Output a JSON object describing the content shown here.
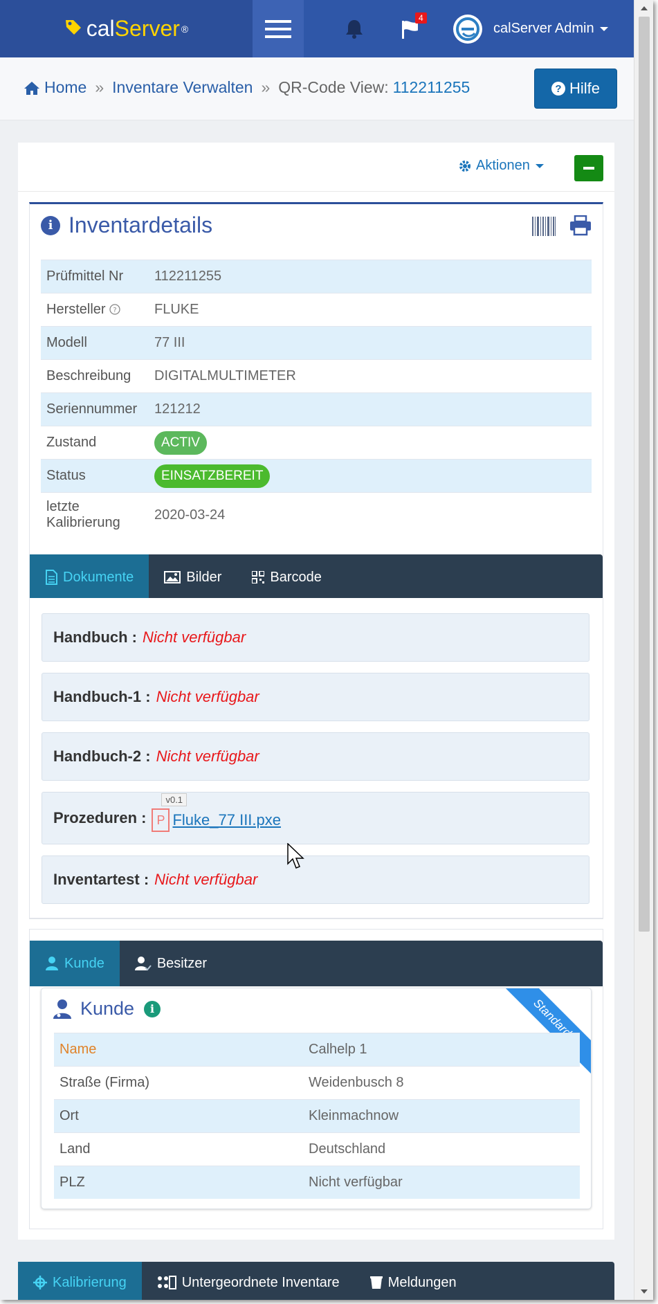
{
  "navbar": {
    "brand_left": "cal",
    "brand_right": "Server",
    "brand_reg": "®",
    "notification_count": "4",
    "user_name": "calServer Admin"
  },
  "breadcrumb": {
    "home": "Home",
    "sep": "»",
    "inventory": "Inventare Verwalten",
    "current_label": "QR-Code View:",
    "current_id": "112211255"
  },
  "help_label": "Hilfe",
  "actions_label": "Aktionen",
  "details": {
    "title": "Inventardetails",
    "rows": [
      {
        "key": "Prüfmittel Nr",
        "value": "112211255"
      },
      {
        "key": "Hersteller",
        "value": "FLUKE"
      },
      {
        "key": "Modell",
        "value": "77 III"
      },
      {
        "key": "Beschreibung",
        "value": "DIGITALMULTIMETER"
      },
      {
        "key": "Seriennummer",
        "value": "121212"
      },
      {
        "key": "Zustand",
        "value": "ACTIV"
      },
      {
        "key": "Status",
        "value": "EINSATZBEREIT"
      },
      {
        "key": "letzte Kalibrierung",
        "value": "2020-03-24"
      }
    ]
  },
  "doc_tabs": [
    "Dokumente",
    "Bilder",
    "Barcode"
  ],
  "documents": [
    {
      "label": "Handbuch :",
      "value": "Nicht verfügbar"
    },
    {
      "label": "Handbuch-1 :",
      "value": "Nicht verfügbar"
    },
    {
      "label": "Handbuch-2 :",
      "value": "Nicht verfügbar"
    },
    {
      "label": "Prozeduren :",
      "file": "Fluke_77 III.pxe",
      "version": "v0.1",
      "file_icon_letter": "P"
    },
    {
      "label": "Inventartest :",
      "value": "Nicht verfügbar"
    }
  ],
  "customer_tabs": [
    "Kunde",
    "Besitzer"
  ],
  "customer": {
    "title": "Kunde",
    "ribbon": "Standard",
    "rows": [
      {
        "key": "Name",
        "value": "Calhelp 1"
      },
      {
        "key": "Straße (Firma)",
        "value": "Weidenbusch 8"
      },
      {
        "key": "Ort",
        "value": "Kleinmachnow"
      },
      {
        "key": "Land",
        "value": "Deutschland"
      },
      {
        "key": "PLZ",
        "value": "Nicht verfügbar"
      }
    ]
  },
  "bottom_tabs": [
    "Kalibrierung",
    "Untergeordnete Inventare",
    "Meldungen"
  ],
  "colors": {
    "navbar": "#2f57a8",
    "accent": "#1b75bb",
    "tab_bar": "#2c3e50",
    "unavailable": "#e8181b",
    "status_green": "#4bba2e"
  }
}
